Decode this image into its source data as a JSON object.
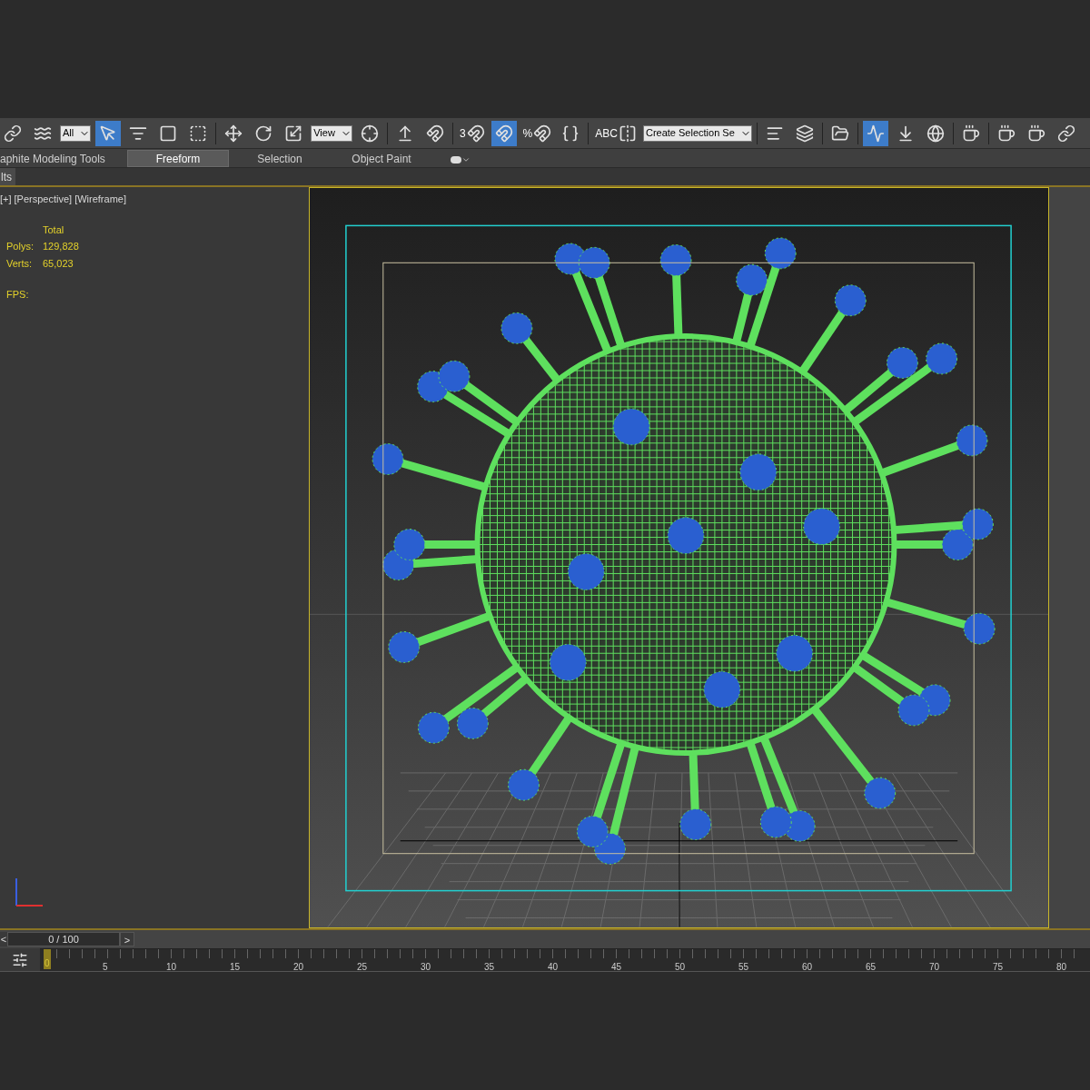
{
  "toolbar": [
    {
      "kind": "icon",
      "selected": false
    },
    {
      "kind": "icon",
      "selected": false
    },
    {
      "kind": "dropdown",
      "value": "All"
    },
    {
      "kind": "icon",
      "selected": true
    },
    {
      "kind": "icon",
      "selected": false
    },
    {
      "kind": "icon",
      "selected": false
    },
    {
      "kind": "icon",
      "selected": false
    },
    {
      "kind": "separator"
    },
    {
      "kind": "icon",
      "selected": false
    },
    {
      "kind": "icon",
      "selected": false
    },
    {
      "kind": "icon",
      "selected": false
    },
    {
      "kind": "dropdown",
      "value": "View"
    },
    {
      "kind": "icon",
      "selected": false
    },
    {
      "kind": "separator"
    },
    {
      "kind": "icon",
      "selected": false
    },
    {
      "kind": "icon",
      "selected": false
    },
    {
      "kind": "separator"
    },
    {
      "kind": "icon",
      "selected": false,
      "label": "3"
    },
    {
      "kind": "icon",
      "selected": true
    },
    {
      "kind": "icon",
      "selected": false,
      "label": "%"
    },
    {
      "kind": "icon",
      "selected": false
    },
    {
      "kind": "separator"
    },
    {
      "kind": "icon",
      "selected": false,
      "label": "ABC"
    },
    {
      "kind": "dropdown",
      "value": "Create Selection Se"
    },
    {
      "kind": "separator"
    },
    {
      "kind": "icon",
      "selected": false
    },
    {
      "kind": "icon",
      "selected": false
    },
    {
      "kind": "separator"
    },
    {
      "kind": "icon",
      "selected": false
    },
    {
      "kind": "separator"
    },
    {
      "kind": "icon",
      "selected": true
    },
    {
      "kind": "icon",
      "selected": false
    },
    {
      "kind": "icon",
      "selected": false
    },
    {
      "kind": "separator"
    },
    {
      "kind": "icon",
      "selected": false
    },
    {
      "kind": "separator"
    },
    {
      "kind": "icon",
      "selected": false
    },
    {
      "kind": "icon",
      "selected": false
    },
    {
      "kind": "icon",
      "selected": false
    }
  ],
  "ribbon_tabs": [
    {
      "label": "aphite Modeling Tools",
      "selected": false
    },
    {
      "label": "Freeform",
      "selected": true
    },
    {
      "label": "Selection",
      "selected": false
    },
    {
      "label": "Object Paint",
      "selected": false
    }
  ],
  "ribbon_subtab": "lts",
  "viewport": {
    "labels": [
      "[+]",
      "[Perspective]",
      "[Wireframe]"
    ],
    "stats_header": "Total",
    "stats": [
      {
        "label": "Polys:",
        "value": "129,828"
      },
      {
        "label": "Verts:",
        "value": "65,023"
      }
    ],
    "fps_label": "FPS:"
  },
  "timeslider": {
    "prev": "<",
    "frame": "0 / 100",
    "next": ">"
  },
  "ruler": {
    "current": "0",
    "labels": [
      "5",
      "10",
      "15",
      "20",
      "25",
      "30",
      "35",
      "40",
      "45",
      "50",
      "55",
      "60",
      "65",
      "70",
      "75",
      "80"
    ]
  }
}
